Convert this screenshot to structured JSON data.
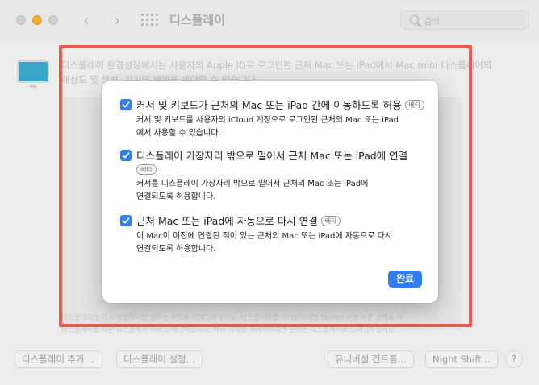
{
  "window": {
    "title": "디스플레이"
  },
  "search": {
    "placeholder": "검색"
  },
  "background": {
    "description_line1": "디스플레이 환경설정에서는 사용자의 Apple ID로 로그인한 근처 Mac 또는 iPad에서 Mac mini 디스플레이의",
    "description_line2": "해상도 및 색상, 기기의 배열을 제어할 수 있습니다.",
    "help_line1": "디스플레이를 다시 정렬하려면 원하는 위치로 드래그하십시오. 디스플레이를 미러링하려면 Option 키를 누른 상태로 각",
    "help_line2": "디스플레이를 다른 디스플레이 위로 드래그하십시오. 메뉴 막대를 재배치하려면 원하는 디스플레이로 드래그하십시오."
  },
  "bottom_bar": {
    "add_display": "디스플레이 추가",
    "display_settings": "디스플레이 설정...",
    "universal_control": "유니버설 컨트롤...",
    "night_shift": "Night Shift...",
    "help": "?"
  },
  "sheet": {
    "beta_label": "베타",
    "options": [
      {
        "title": "커서 및 키보드가 근처의 Mac 또는 iPad 간에 이동하도록 허용",
        "desc_line1": "커서 및 키보드를 사용자의 iCloud 계정으로 로그인된 근처의 Mac 또는 iPad",
        "desc_line2": "에서 사용할 수 있습니다.",
        "checked": true
      },
      {
        "title": "디스플레이 가장자리 밖으로 밀어서 근처 Mac 또는 iPad에 연결",
        "desc_line1": "커서를 디스플레이 가장자리 밖으로 밀어서 근처의 Mac 또는 iPad에",
        "desc_line2": "연결되도록 허용합니다.",
        "checked": true
      },
      {
        "title": "근처 Mac 또는 iPad에 자동으로 다시 연결",
        "desc_line1": "이 Mac이 이전에 연결된 적이 있는 근처의 Mac 또는 iPad에 자동으로 다시",
        "desc_line2": "연결되도록 허용합니다.",
        "checked": true
      }
    ],
    "done_label": "완료"
  },
  "colors": {
    "accent": "#2f7ff2",
    "highlight": "#ea5a53"
  }
}
